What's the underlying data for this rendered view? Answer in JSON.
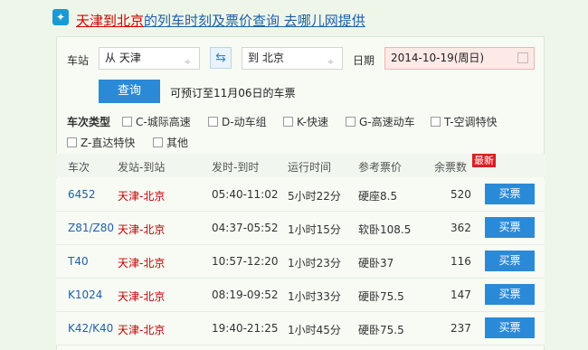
{
  "header": {
    "route_link": "天津到北京",
    "rest_link": "的列车时刻及票价查询 去哪儿网提供"
  },
  "form": {
    "station_label": "车站",
    "from_value": "从 天津",
    "to_value": "到 北京",
    "date_label": "日期",
    "date_value": "2014-10-19(周日)",
    "query_label": "查询",
    "hint": "可预订至11月06日的车票"
  },
  "filters": {
    "title": "车次类型",
    "options": [
      "C-城际高速",
      "D-动车组",
      "K-快速",
      "G-高速动车",
      "T-空调特快",
      "Z-直达特快",
      "其他"
    ]
  },
  "table": {
    "headers": [
      "车次",
      "发站-到站",
      "发时-到时",
      "运行时间",
      "参考票价",
      "余票数"
    ],
    "new_badge": "最新",
    "buy_label": "买票",
    "rows": [
      {
        "train": "6452",
        "route": "天津-北京",
        "time": "05:40-11:02",
        "duration": "5小时22分",
        "price": "硬座8.5",
        "left": "520"
      },
      {
        "train": "Z81/Z80",
        "route": "天津-北京",
        "time": "04:37-05:52",
        "duration": "1小时15分",
        "price": "软卧108.5",
        "left": "362"
      },
      {
        "train": "T40",
        "route": "天津-北京",
        "time": "10:57-12:20",
        "duration": "1小时23分",
        "price": "硬卧37",
        "left": "116"
      },
      {
        "train": "K1024",
        "route": "天津-北京",
        "time": "08:19-09:52",
        "duration": "1小时33分",
        "price": "硬卧75.5",
        "left": "147"
      },
      {
        "train": "K42/K40",
        "route": "天津-北京",
        "time": "19:40-21:25",
        "duration": "1小时45分",
        "price": "硬卧75.5",
        "left": "237"
      }
    ]
  }
}
